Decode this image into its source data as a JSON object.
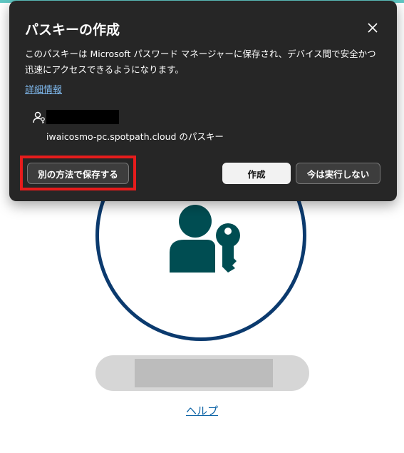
{
  "dialog": {
    "title": "パスキーの作成",
    "description": "このパスキーは Microsoft パスワード マネージャーに保存され、デバイス間で安全かつ迅速にアクセスできるようになります。",
    "more_info_link": "詳細情報",
    "site_label": "iwaicosmo-pc.spotpath.cloud のパスキー",
    "buttons": {
      "save_another_way": "別の方法で保存する",
      "create": "作成",
      "not_now": "今は実行しない"
    },
    "highlight_color": "#e61c1c"
  },
  "page": {
    "help_link": "ヘルプ",
    "accent_color": "#5fc7c3",
    "icon_color": "#004d52",
    "ring_color": "#0b3a6e"
  },
  "icons": [
    "close-icon",
    "user-key-icon",
    "passkey-illustration"
  ]
}
